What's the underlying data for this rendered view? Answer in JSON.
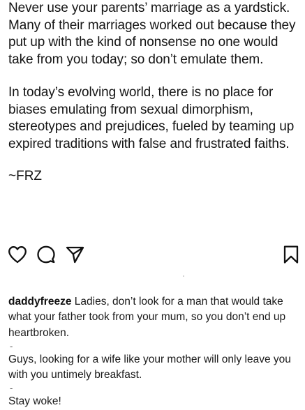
{
  "post": {
    "paragraph1": "Never use your parents’ marriage as a yardstick. Many of their marriages worked out because they put up with the kind of nonsense no one would take from you today; so don’t emulate them.",
    "paragraph2": "In today’s evolving world, there is no place for biases emulating from sexual dimorphism, stereotypes and prejudices, fueled by teaming up expired traditions with false and frustrated faiths.",
    "signature": "~FRZ"
  },
  "actions": {
    "like_icon": "heart-outline-icon",
    "comment_icon": "comment-bubble-icon",
    "share_icon": "paper-plane-icon",
    "save_icon": "bookmark-icon"
  },
  "caption": {
    "username": "daddyfreeze",
    "text1": "Ladies, don’t look for a man that would take what your father took from your mum, so you don’t end up heartbroken.",
    "separator1": "-",
    "text2": "Guys, looking for a wife like your mother will only leave you with you untimely breakfast.",
    "separator2": "-",
    "text3": "Stay woke!"
  },
  "colors": {
    "text": "#141414",
    "icon_stroke": "#111111",
    "background": "#ffffff"
  }
}
